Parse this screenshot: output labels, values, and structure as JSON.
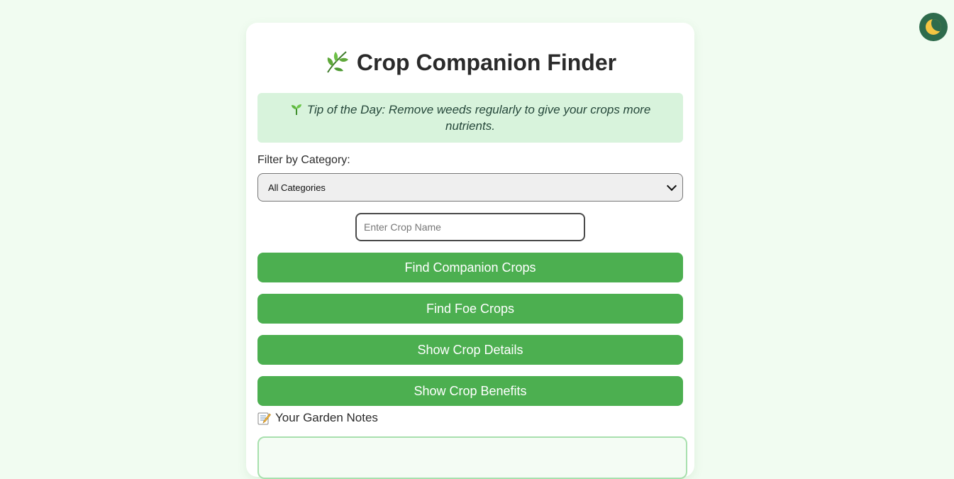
{
  "theme_toggle": {
    "icon": "moon-icon"
  },
  "header": {
    "title": "Crop Companion Finder",
    "icon": "leaf-icon"
  },
  "tip": {
    "icon": "sprout-icon",
    "text": "Tip of the Day: Remove weeds regularly to give your crops more nutrients."
  },
  "filter": {
    "label": "Filter by Category:",
    "selected": "All Categories"
  },
  "crop_input": {
    "placeholder": "Enter Crop Name",
    "value": ""
  },
  "buttons": {
    "find_companion": "Find Companion Crops",
    "find_foe": "Find Foe Crops",
    "show_details": "Show Crop Details",
    "show_benefits": "Show Crop Benefits"
  },
  "notes": {
    "icon": "memo-icon",
    "label": "Your Garden Notes",
    "value": ""
  },
  "colors": {
    "background": "#f1fcf1",
    "button": "#4caf50",
    "tip_background": "#d8f3dc",
    "toggle_background": "#2e6b4c"
  }
}
